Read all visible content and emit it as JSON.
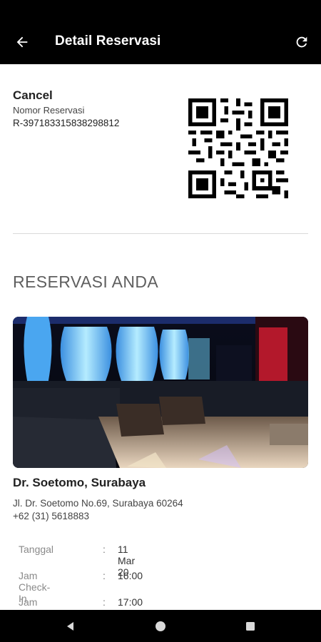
{
  "app_bar": {
    "title": "Detail Reservasi",
    "back_icon": "arrow-left-icon",
    "refresh_icon": "refresh-icon"
  },
  "reservation": {
    "status": "Cancel",
    "number_label": "Nomor Reservasi",
    "number": "R-397183315838298812"
  },
  "section_title": "RESERVASI ANDA",
  "venue": {
    "name": "Dr. Soetomo, Surabaya",
    "address": "Jl. Dr. Soetomo No.69, Surabaya 60264",
    "phone": "+62 (31) 5618883"
  },
  "details": [
    {
      "label": "Tanggal",
      "separator": ":",
      "value": "11 Mar 20"
    },
    {
      "label": "Jam Check-In",
      "separator": ":",
      "value": "16:00"
    },
    {
      "label": "Jam Check-Out",
      "separator": ":",
      "value": "17:00"
    }
  ],
  "nav_bar": {
    "back_icon": "triangle-back-icon",
    "home_icon": "circle-home-icon",
    "recents_icon": "square-recents-icon"
  },
  "colors": {
    "app_bar": "#000000",
    "section_title": "#5f5f5f",
    "label": "#8a8a8a"
  }
}
